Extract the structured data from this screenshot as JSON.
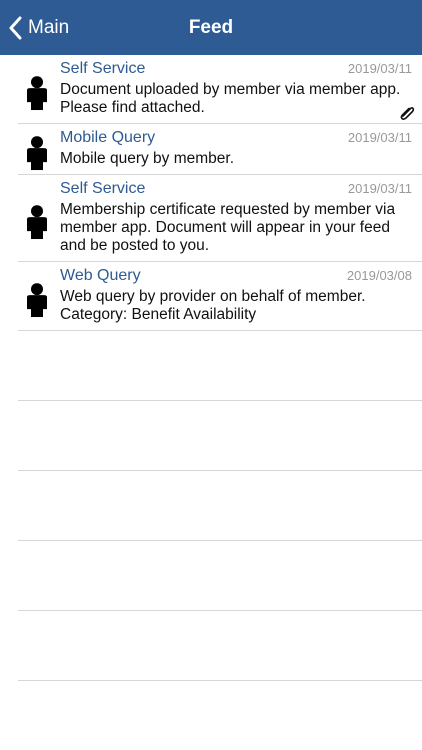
{
  "nav": {
    "back_label": "Main",
    "title": "Feed",
    "bar_color": "#2e5b93"
  },
  "feed": [
    {
      "title": "Self Service",
      "date": "2019/03/11",
      "body": "Document uploaded by member via member app. Please find attached.",
      "icon": "person-icon",
      "has_attachment": true
    },
    {
      "title": "Mobile Query",
      "date": "2019/03/11",
      "body": "Mobile query by member.",
      "icon": "person-icon",
      "has_attachment": false
    },
    {
      "title": "Self Service",
      "date": "2019/03/11",
      "body": "Membership certificate requested by member via member app. Document will appear in your feed and be posted to you.",
      "icon": "person-icon",
      "has_attachment": false
    },
    {
      "title": "Web Query",
      "date": "2019/03/08",
      "body": "Web query by provider on behalf of member. Category: Benefit Availability",
      "icon": "person-icon",
      "has_attachment": false
    }
  ],
  "colors": {
    "title": "#2e5b93",
    "date": "#999999",
    "separator": "#d6d6d6"
  }
}
